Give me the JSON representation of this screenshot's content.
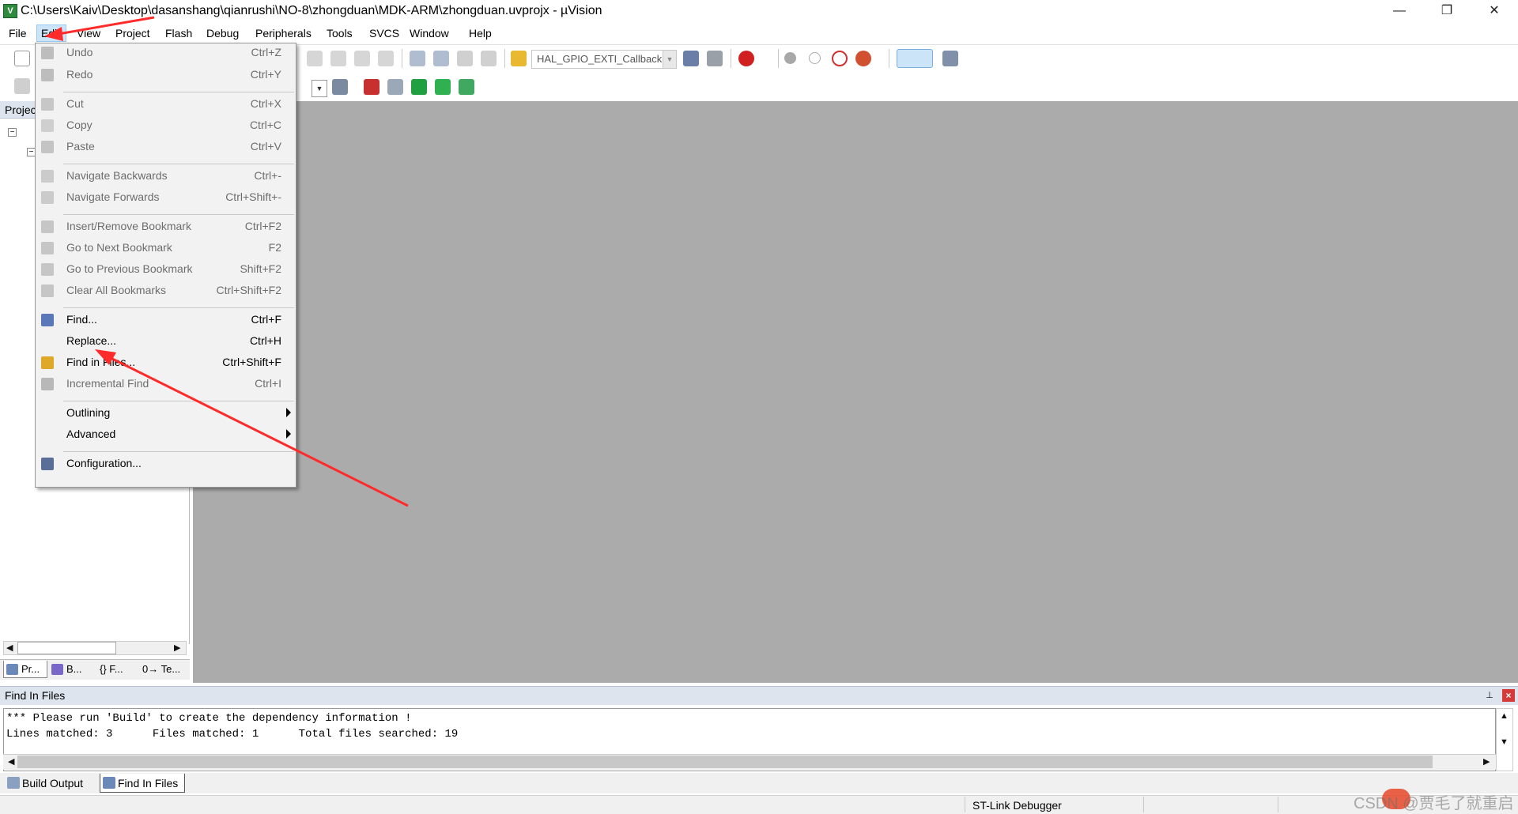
{
  "window": {
    "title": "C:\\Users\\Kaiv\\Desktop\\dasanshang\\qianrushi\\NO-8\\zhongduan\\MDK-ARM\\zhongduan.uvprojx - µVision",
    "minimize": "—",
    "restore": "❐",
    "close": "✕"
  },
  "menubar": [
    "File",
    "Edit",
    "View",
    "Project",
    "Flash",
    "Debug",
    "Peripherals",
    "Tools",
    "SVCS",
    "Window",
    "Help"
  ],
  "toolbar": {
    "function_combo": "HAL_GPIO_EXTI_Callback"
  },
  "project_panel": {
    "header": "Projec",
    "tabs": [
      "Pr...",
      "B...",
      "{} F...",
      "0→ Te..."
    ]
  },
  "edit_menu": {
    "items": [
      {
        "label": "Undo",
        "shortcut": "Ctrl+Z",
        "icon": "undo-icon",
        "enabled": false
      },
      {
        "label": "Redo",
        "shortcut": "Ctrl+Y",
        "icon": "redo-icon",
        "enabled": false
      },
      {
        "label": "Cut",
        "shortcut": "Ctrl+X",
        "icon": "cut-icon",
        "enabled": false
      },
      {
        "label": "Copy",
        "shortcut": "Ctrl+C",
        "icon": "copy-icon",
        "enabled": false
      },
      {
        "label": "Paste",
        "shortcut": "Ctrl+V",
        "icon": "paste-icon",
        "enabled": false
      },
      {
        "label": "Navigate Backwards",
        "shortcut": "Ctrl+-",
        "icon": "navigate-back-icon",
        "enabled": false
      },
      {
        "label": "Navigate Forwards",
        "shortcut": "Ctrl+Shift+-",
        "icon": "navigate-forward-icon",
        "enabled": false
      },
      {
        "label": "Insert/Remove Bookmark",
        "shortcut": "Ctrl+F2",
        "icon": "bookmark-icon",
        "enabled": false
      },
      {
        "label": "Go to Next Bookmark",
        "shortcut": "F2",
        "icon": "next-bookmark-icon",
        "enabled": false
      },
      {
        "label": "Go to Previous Bookmark",
        "shortcut": "Shift+F2",
        "icon": "prev-bookmark-icon",
        "enabled": false
      },
      {
        "label": "Clear All Bookmarks",
        "shortcut": "Ctrl+Shift+F2",
        "icon": "clear-bookmarks-icon",
        "enabled": false
      },
      {
        "label": "Find...",
        "shortcut": "Ctrl+F",
        "icon": "find-icon",
        "enabled": true
      },
      {
        "label": "Replace...",
        "shortcut": "Ctrl+H",
        "icon": "",
        "enabled": true
      },
      {
        "label": "Find in Files...",
        "shortcut": "Ctrl+Shift+F",
        "icon": "find-in-files-icon",
        "enabled": true
      },
      {
        "label": "Incremental Find",
        "shortcut": "Ctrl+I",
        "icon": "incremental-find-icon",
        "enabled": false
      },
      {
        "label": "Outlining",
        "shortcut": "",
        "icon": "",
        "enabled": true,
        "submenu": true
      },
      {
        "label": "Advanced",
        "shortcut": "",
        "icon": "",
        "enabled": true,
        "submenu": true
      },
      {
        "label": "Configuration...",
        "shortcut": "",
        "icon": "wrench-icon",
        "enabled": true
      }
    ]
  },
  "find_in_files": {
    "title": "Find In Files",
    "line1": "*** Please run 'Build' to create the dependency information !",
    "line2": "Lines matched: 3      Files matched: 1      Total files searched: 19"
  },
  "bottom_tabs": [
    "Build Output",
    "Find In Files"
  ],
  "status": {
    "debugger": "ST-Link Debugger",
    "watermark": "CSDN @贾毛了就重启"
  },
  "colors": {
    "editor_bg": "#ababab",
    "menu_bg": "#f2f2f2",
    "annotation": "#ff2a2a"
  }
}
